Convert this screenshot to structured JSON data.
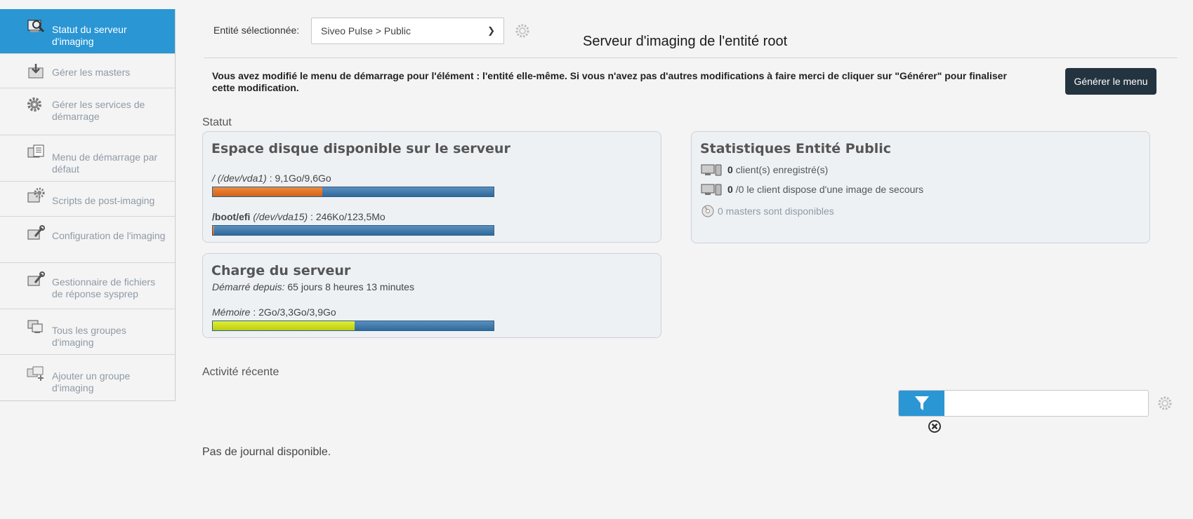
{
  "sidebar": {
    "items": [
      {
        "label": "Statut du serveur d'imaging",
        "icon": "server-status-icon",
        "active": true
      },
      {
        "label": "Gérer les masters",
        "icon": "masters-icon"
      },
      {
        "label": "Gérer les services de démarrage",
        "icon": "gear-icon"
      },
      {
        "label": "Menu de démarrage par défaut",
        "icon": "boot-menu-icon"
      },
      {
        "label": "Scripts de post-imaging",
        "icon": "post-imaging-scripts-icon"
      },
      {
        "label": "Configuration de l'imaging",
        "icon": "imaging-config-icon"
      },
      {
        "label": "Gestionnaire de fichiers de réponse sysprep",
        "icon": "sysprep-icon"
      },
      {
        "label": "Tous les groupes d'imaging",
        "icon": "groups-icon"
      },
      {
        "label": "Ajouter un groupe d'imaging",
        "icon": "add-group-icon"
      }
    ]
  },
  "header": {
    "entity_label": "Entité sélectionnée:",
    "entity_value": "Siveo Pulse > Public",
    "title": "Serveur d'imaging de l'entité root"
  },
  "notice": {
    "text": "Vous avez modifié le menu de démarrage pour l'élément : l'entité elle-même. Si vous n'avez pas d'autres modifications à faire merci de cliquer sur \"Générer\" pour finaliser cette modification.",
    "button": "Générer le menu"
  },
  "status": {
    "section_label": "Statut",
    "disk": {
      "title": "Espace disque disponible sur le serveur",
      "partitions": [
        {
          "mount": "/",
          "device": "(/dev/vda1)",
          "sep": " : ",
          "usage": "9,1Go/9,6Go",
          "used_fraction": 0.39
        },
        {
          "mount": "/boot/efi",
          "device": "(/dev/vda15)",
          "sep": " : ",
          "usage": "246Ko/123,5Mo",
          "used_fraction": 0.005
        }
      ]
    },
    "load": {
      "title": "Charge du serveur",
      "uptime_label": "Démarré depuis:",
      "uptime_value": " 65 jours 8 heures 13 minutes",
      "memory_label": "Mémoire",
      "memory_value": " : 2Go/3,3Go/3,9Go",
      "memory_fraction": 0.505
    },
    "stats": {
      "title": "Statistiques Entité Public",
      "clients_count": "0",
      "clients_text": "client(s) enregistré(s)",
      "rescue_count": "0",
      "rescue_text": "/0 le client dispose d'une image de secours",
      "masters_text": "0 masters sont disponibles"
    }
  },
  "activity": {
    "section_label": "Activité récente",
    "filter_placeholder": "",
    "empty": "Pas de journal disponible."
  },
  "colors": {
    "accent": "#2a96d4",
    "button_dark": "#243340",
    "bar_blue": "#3d77aa",
    "bar_orange": "#e06f28",
    "bar_yellow": "#cfe01f"
  }
}
